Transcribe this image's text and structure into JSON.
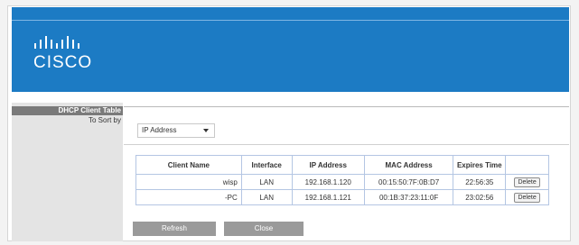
{
  "brand": {
    "logo_text": "CISCO"
  },
  "section": {
    "title": "DHCP Client Table"
  },
  "sort": {
    "label": "To Sort by",
    "selected": "IP Address"
  },
  "table": {
    "headers": [
      "Client Name",
      "Interface",
      "IP Address",
      "MAC Address",
      "Expires Time",
      ""
    ],
    "rows": [
      {
        "client_name": "wisp",
        "interface": "LAN",
        "ip": "192.168.1.120",
        "mac": "00:15:50:7F:0B:D7",
        "expires": "22:56:35",
        "action": "Delete"
      },
      {
        "client_name": "-PC",
        "interface": "LAN",
        "ip": "192.168.1.121",
        "mac": "00:1B:37:23:11:0F",
        "expires": "23:02:56",
        "action": "Delete"
      }
    ]
  },
  "buttons": {
    "refresh": "Refresh",
    "close": "Close"
  },
  "colors": {
    "banner": "#1c7bc4",
    "table_border": "#b4c6e3"
  }
}
